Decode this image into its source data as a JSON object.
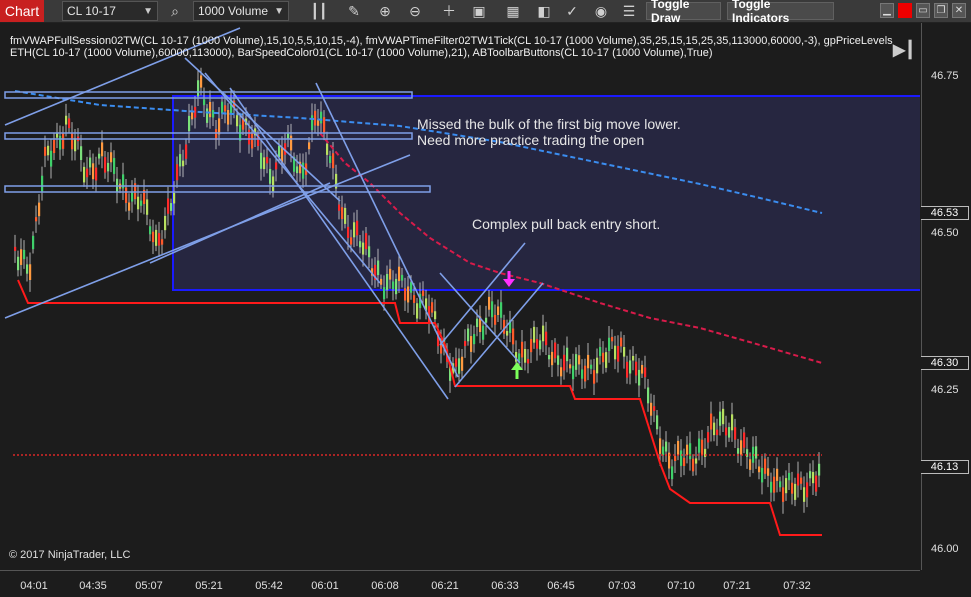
{
  "toolbar": {
    "chart_tab": "Chart",
    "instrument": "CL 10-17",
    "interval": "1000 Volume",
    "toggle_draw": "Toggle Draw",
    "toggle_indicators": "Toggle Indicators"
  },
  "indicators_text": "fmVWAPFullSession02TW(CL 10-17 (1000 Volume),15,10,5,5,10,15,-4), fmVWAPTimeFilter02TW1Tick(CL 10-17 (1000 Volume),35,25,15,15,25,35,113000,60000,-3), gpPriceLevels ETH(CL 10-17 (1000 Volume),60000,113000), BarSpeedColor01(CL 10-17 (1000 Volume),21), ABToolbarButtons(CL 10-17 (1000 Volume),True)",
  "annotations": {
    "note1_line1": "Missed the bulk of the first big move lower.",
    "note1_line2": "Need more practice trading the open",
    "note2": "Complex pull back entry short."
  },
  "copyright": "© 2017 NinjaTrader, LLC",
  "price_axis": {
    "ticks": [
      "46.75",
      "46.50",
      "46.25",
      "46.00"
    ],
    "markers": [
      "46.53",
      "46.30",
      "46.13"
    ]
  },
  "time_axis": [
    "04:01",
    "04:35",
    "05:07",
    "05:21",
    "05:42",
    "06:01",
    "06:08",
    "06:21",
    "06:33",
    "06:45",
    "07:03",
    "07:10",
    "07:21",
    "07:32"
  ],
  "colors": {
    "chart_tab": "#c82020",
    "box_border": "#1a1aff",
    "vwap_dashed": "#3b8df0",
    "vwap_red": "#d81b4a",
    "stop_line": "#ff1a1a",
    "trendline": "#7f9fe8",
    "entry_arrow": "#ff30ff",
    "up_arrow": "#7cff5a"
  },
  "icons": [
    "dropdown-arrow-icon",
    "search-icon",
    "bar-style-icon",
    "pencil-icon",
    "zoom-in-icon",
    "zoom-out-icon",
    "crosshair-icon",
    "properties-icon",
    "data-box-icon",
    "bars-back-icon",
    "strategy-icon",
    "reload-icon",
    "indicators-list-icon",
    "minimize-icon",
    "close-icon",
    "maximize-icon",
    "restore-icon",
    "play-icon"
  ]
}
